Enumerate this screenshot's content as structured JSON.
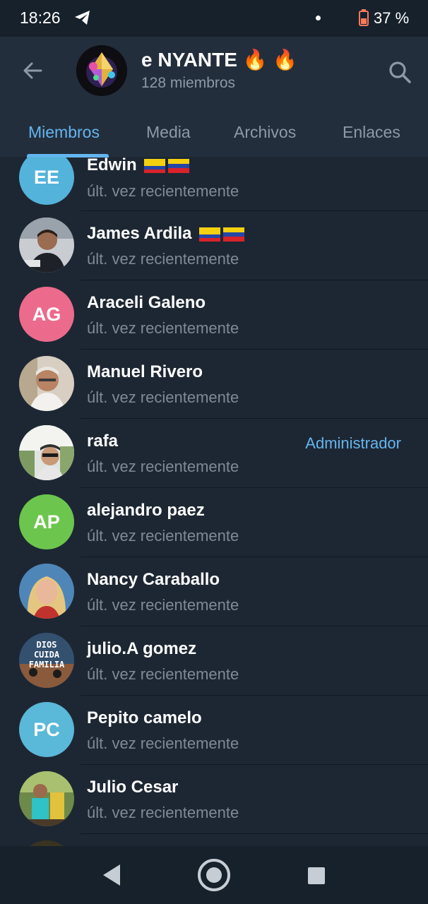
{
  "status_bar": {
    "time": "18:26",
    "battery": "37 %"
  },
  "header": {
    "title": "e NYANTE 🔥  🔥",
    "subtitle": "128 miembros"
  },
  "tabs": [
    {
      "label": "Miembros"
    },
    {
      "label": "Media"
    },
    {
      "label": "Archivos"
    },
    {
      "label": "Enlaces"
    }
  ],
  "members": [
    {
      "name": "Edwin",
      "status": "últ. vez recientemente",
      "initials": "EE",
      "avatar_color": "#54b3da"
    },
    {
      "name": "James Ardila",
      "status": "últ. vez recientemente"
    },
    {
      "name": "Araceli Galeno",
      "status": "últ. vez recientemente",
      "initials": "AG",
      "avatar_color": "#ec6a8c"
    },
    {
      "name": "Manuel Rivero",
      "status": "últ. vez recientemente"
    },
    {
      "name": "rafa",
      "status": "últ. vez recientemente",
      "role": "Administrador"
    },
    {
      "name": "alejandro paez",
      "status": "últ. vez recientemente",
      "initials": "AP",
      "avatar_color": "#6cc64d"
    },
    {
      "name": "Nancy Caraballo",
      "status": "últ. vez recientemente"
    },
    {
      "name": "julio.A gomez",
      "status": "últ. vez recientemente",
      "avatar_text": "DIOS CUIDA FAMILIA"
    },
    {
      "name": "Pepito camelo",
      "status": "últ. vez recientemente",
      "initials": "PC",
      "avatar_color": "#5ab8d8"
    },
    {
      "name": "Julio Cesar",
      "status": "últ. vez recientemente"
    }
  ],
  "colors": {
    "accent": "#64b5ef",
    "background": "#1d2733",
    "header": "#232e3c"
  }
}
